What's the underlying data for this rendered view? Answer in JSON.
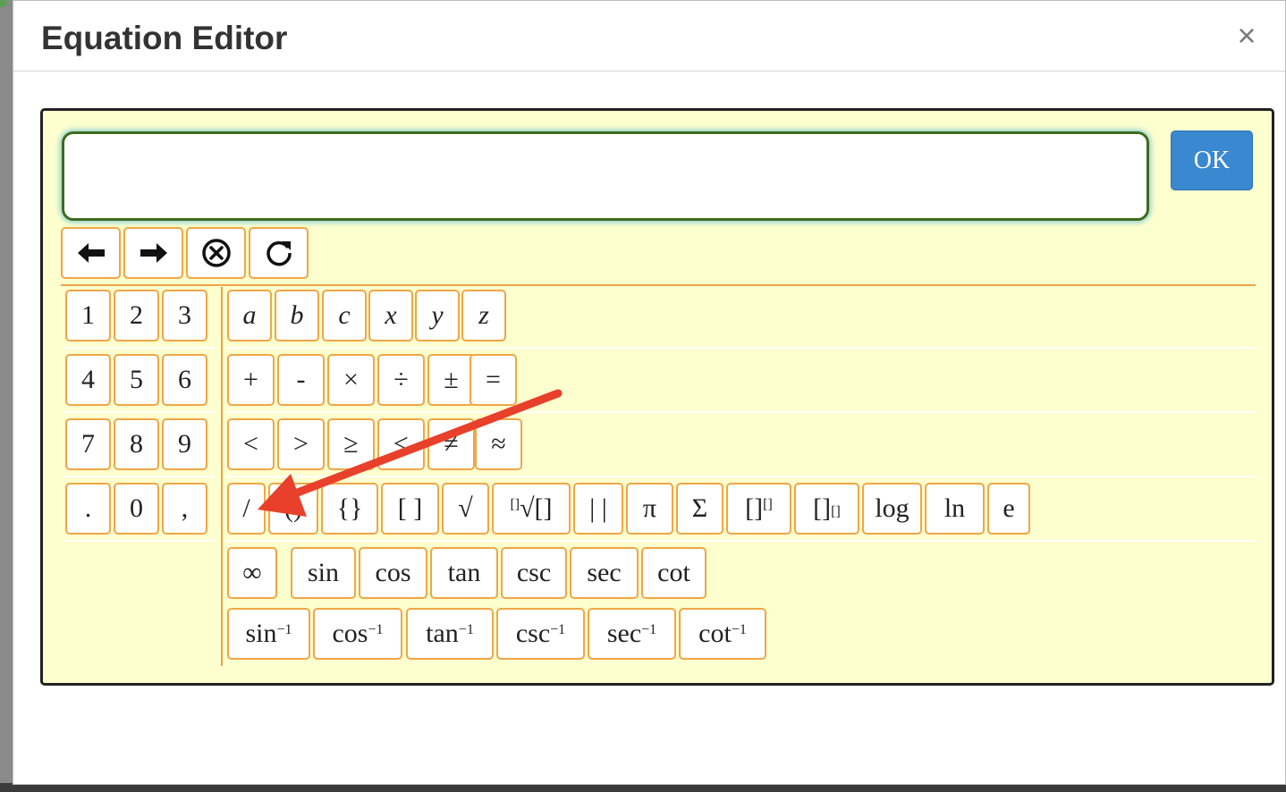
{
  "dialog": {
    "title": "Equation Editor",
    "close_label": "×",
    "ok_label": "OK",
    "input_value": ""
  },
  "controls": [
    {
      "name": "cursor-left-button",
      "icon": "arrow-left-icon"
    },
    {
      "name": "cursor-right-button",
      "icon": "arrow-right-icon"
    },
    {
      "name": "delete-button",
      "icon": "circle-x-icon"
    },
    {
      "name": "reset-button",
      "icon": "refresh-icon"
    }
  ],
  "numpad": {
    "rows": [
      [
        "1",
        "2",
        "3"
      ],
      [
        "4",
        "5",
        "6"
      ],
      [
        "7",
        "8",
        "9"
      ],
      [
        ".",
        "0",
        ","
      ]
    ]
  },
  "symbols": {
    "variables": [
      "a",
      "b",
      "c",
      "x",
      "y",
      "z"
    ],
    "operators": [
      "+",
      "-",
      "×",
      "÷",
      "±",
      "="
    ],
    "relations": [
      "<",
      ">",
      "≥",
      "≤",
      "≠",
      "≈"
    ],
    "structures": [
      "/",
      "()",
      "{}",
      "[ ]",
      "√",
      "[]√[]",
      "| |",
      "π",
      "Σ",
      "[][]",
      "[][]",
      "log",
      "ln",
      "e"
    ],
    "trig": [
      "∞",
      "sin",
      "cos",
      "tan",
      "csc",
      "sec",
      "cot"
    ],
    "inverse_trig": {
      "names": [
        "sin",
        "cos",
        "tan",
        "csc",
        "sec",
        "cot"
      ],
      "exponent": "−1"
    }
  },
  "colors": {
    "panel_background": "#fdffce",
    "key_border": "#f0a645",
    "ok_button": "#3a88cf",
    "annotation_arrow": "#e8402a"
  }
}
